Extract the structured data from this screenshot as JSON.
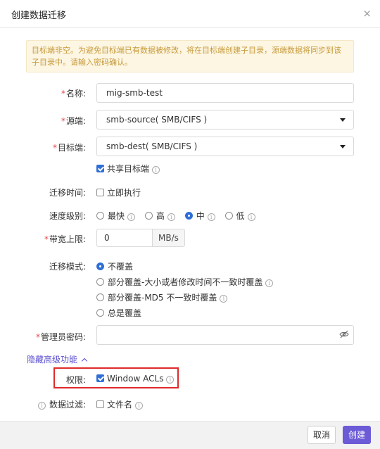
{
  "dialog": {
    "title": "创建数据迁移",
    "close": "×"
  },
  "alert": {
    "text": "目标端非空。为避免目标端已有数据被修改，将在目标端创建子目录，源端数据将同步到该子目录中。请输入密码确认。"
  },
  "form": {
    "name": {
      "label": "名称:",
      "required": "*",
      "value": "mig-smb-test"
    },
    "source": {
      "label": "源端:",
      "required": "*",
      "value": "smb-source( SMB/CIFS )"
    },
    "dest": {
      "label": "目标端:",
      "required": "*",
      "value": "smb-dest( SMB/CIFS )"
    },
    "share_dest": {
      "label": "共享目标端",
      "checked": true
    },
    "migrate_time": {
      "label": "迁移时间:",
      "option": "立即执行",
      "checked": false
    },
    "speed": {
      "label": "速度级别:",
      "options": [
        {
          "label": "最快",
          "checked": false
        },
        {
          "label": "高",
          "checked": false
        },
        {
          "label": "中",
          "checked": true
        },
        {
          "label": "低",
          "checked": false
        }
      ]
    },
    "bandwidth": {
      "label": "带宽上限:",
      "required": "*",
      "value": "0",
      "unit": "MB/s"
    },
    "mode": {
      "label": "迁移模式:",
      "options": [
        {
          "label": "不覆盖",
          "checked": true,
          "info": false
        },
        {
          "label": "部分覆盖-大小或者修改时间不一致时覆盖",
          "checked": false,
          "info": true
        },
        {
          "label": "部分覆盖-MD5 不一致时覆盖",
          "checked": false,
          "info": true
        },
        {
          "label": "总是覆盖",
          "checked": false,
          "info": false
        }
      ]
    },
    "admin_password": {
      "label": "管理员密码:",
      "required": "*",
      "value": ""
    },
    "advanced_toggle": "隐藏高级功能",
    "permissions": {
      "label": "权限:",
      "option": "Window ACLs",
      "checked": true
    },
    "data_filter": {
      "label": "数据过滤:",
      "option": "文件名",
      "checked": false
    }
  },
  "footer": {
    "cancel": "取消",
    "create": "创建"
  },
  "colors": {
    "primary": "#6b5bd6",
    "link": "#5a4fcf",
    "checked": "#2f6fd6",
    "required": "#e5484d",
    "alert_bg": "#fdf6e3",
    "alert_text": "#c79a3a",
    "highlight": "#e02a2a"
  }
}
